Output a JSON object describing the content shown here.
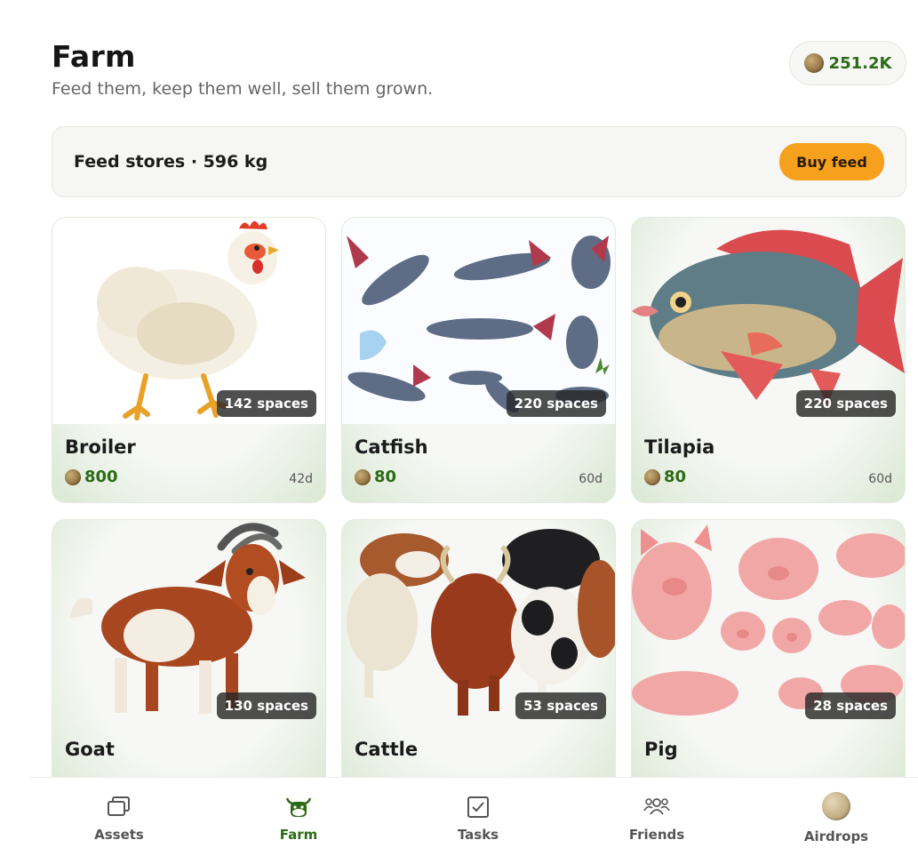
{
  "header": {
    "title": "Farm",
    "subtitle": "Feed them, keep them well, sell them grown.",
    "balance": "251.2K"
  },
  "feed": {
    "text": "Feed stores · 596 kg",
    "buy_label": "Buy feed"
  },
  "animals": [
    {
      "name": "Broiler",
      "price": "800",
      "days": "42d",
      "spaces": "142 spaces",
      "icon": "chicken-illustration"
    },
    {
      "name": "Catfish",
      "price": "80",
      "days": "60d",
      "spaces": "220 spaces",
      "icon": "catfish-illustration"
    },
    {
      "name": "Tilapia",
      "price": "80",
      "days": "60d",
      "spaces": "220 spaces",
      "icon": "tilapia-illustration"
    },
    {
      "name": "Goat",
      "price": "",
      "days": "",
      "spaces": "130 spaces",
      "icon": "goat-illustration"
    },
    {
      "name": "Cattle",
      "price": "",
      "days": "",
      "spaces": "53 spaces",
      "icon": "cattle-illustration"
    },
    {
      "name": "Pig",
      "price": "",
      "days": "",
      "spaces": "28 spaces",
      "icon": "pig-illustration"
    }
  ],
  "nav": {
    "items": [
      {
        "label": "Assets",
        "icon": "assets-icon"
      },
      {
        "label": "Farm",
        "icon": "cow-icon",
        "active": true
      },
      {
        "label": "Tasks",
        "icon": "tasks-checkbox-icon"
      },
      {
        "label": "Friends",
        "icon": "friends-icon"
      },
      {
        "label": "Airdrops",
        "icon": "coin-icon"
      }
    ]
  },
  "colors": {
    "accent_green": "#2c6b16",
    "buy_button": "#f5a11d",
    "card_tint": "#d9e8d3"
  }
}
